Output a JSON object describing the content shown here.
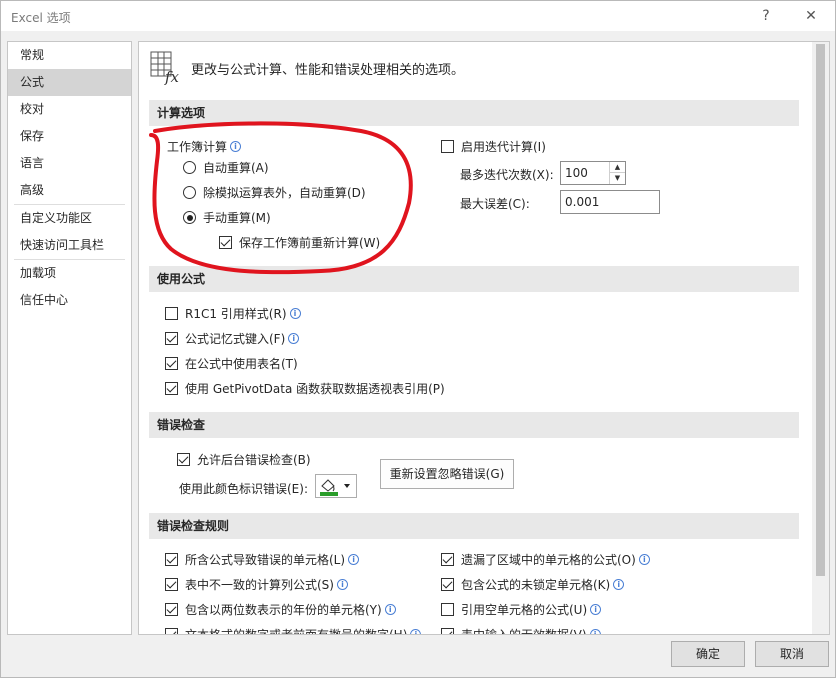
{
  "window": {
    "title": "Excel 选项",
    "help": "?",
    "close": "✕"
  },
  "nav": {
    "items": [
      {
        "label": "常规"
      },
      {
        "label": "公式"
      },
      {
        "label": "校对"
      },
      {
        "label": "保存"
      },
      {
        "label": "语言"
      },
      {
        "label": "高级"
      },
      {
        "label": "自定义功能区"
      },
      {
        "label": "快速访问工具栏"
      },
      {
        "label": "加载项"
      },
      {
        "label": "信任中心"
      }
    ],
    "selected": "公式"
  },
  "header": {
    "text": "更改与公式计算、性能和错误处理相关的选项。",
    "icon": "function-sheet-icon"
  },
  "calc": {
    "section": "计算选项",
    "workbook_label": "工作簿计算",
    "radio_auto": "自动重算(A)",
    "radio_auto_except": "除模拟运算表外，自动重算(D)",
    "radio_manual": "手动重算(M)",
    "recalc_before_save": "保存工作簿前重新计算(W)",
    "iterative": "启用迭代计算(I)",
    "max_iter_label": "最多迭代次数(X):",
    "max_iter_value": "100",
    "max_change_label": "最大误差(C):",
    "max_change_value": "0.001",
    "selected_mode": "manual",
    "recalc_before_save_checked": true,
    "iterative_checked": false
  },
  "formulas": {
    "section": "使用公式",
    "r1c1": "R1C1 引用样式(R)",
    "autocomplete": "公式记忆式键入(F)",
    "table_names": "在公式中使用表名(T)",
    "getpivot": "使用 GetPivotData 函数获取数据透视表引用(P)",
    "checked": [
      false,
      true,
      true,
      true
    ]
  },
  "errors": {
    "section": "错误检查",
    "background": "允许后台错误检查(B)",
    "color_label": "使用此颜色标识错误(E):",
    "reset": "重新设置忽略错误(G)",
    "background_checked": true
  },
  "rules": {
    "section": "错误检查规则",
    "left": [
      {
        "label": "所含公式导致错误的单元格(L)",
        "checked": true
      },
      {
        "label": "表中不一致的计算列公式(S)",
        "checked": true
      },
      {
        "label": "包含以两位数表示的年份的单元格(Y)",
        "checked": true
      },
      {
        "label": "文本格式的数字或者前面有撇号的数字(H)",
        "checked": true
      }
    ],
    "right": [
      {
        "label": "遗漏了区域中的单元格的公式(O)",
        "checked": true
      },
      {
        "label": "包含公式的未锁定单元格(K)",
        "checked": true
      },
      {
        "label": "引用空单元格的公式(U)",
        "checked": false
      },
      {
        "label": "表中输入的无效数据(V)",
        "checked": true
      }
    ]
  },
  "footer": {
    "ok": "确定",
    "cancel": "取消"
  },
  "colors": {
    "annotation": "#e0141e",
    "selected_nav": "#d4d4d4",
    "section_bg": "#e8e8e8"
  }
}
